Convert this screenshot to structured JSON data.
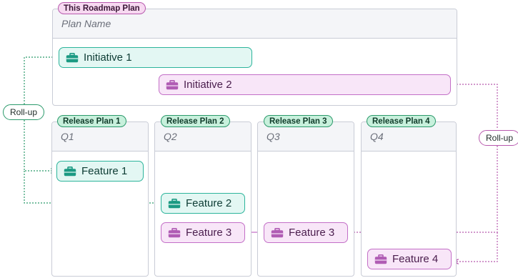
{
  "plan": {
    "tag": "This Roadmap Plan",
    "name_placeholder": "Plan Name"
  },
  "initiatives": [
    {
      "label": "Initiative 1",
      "icon": "briefcase-icon",
      "color": "#2cb49b"
    },
    {
      "label": "Initiative 2",
      "icon": "briefcase-icon",
      "color": "#c36fc7"
    }
  ],
  "release_plans": [
    {
      "tag": "Release Plan 1",
      "quarter": "Q1"
    },
    {
      "tag": "Release Plan 2",
      "quarter": "Q2"
    },
    {
      "tag": "Release Plan 3",
      "quarter": "Q3"
    },
    {
      "tag": "Release Plan 4",
      "quarter": "Q4"
    }
  ],
  "features": [
    {
      "label": "Feature 1",
      "icon": "briefcase-icon"
    },
    {
      "label": "Feature 2",
      "icon": "briefcase-icon"
    },
    {
      "label": "Feature 3",
      "icon": "briefcase-icon"
    },
    {
      "label": "Feature 3",
      "icon": "briefcase-icon"
    },
    {
      "label": "Feature 4",
      "icon": "briefcase-icon"
    }
  ],
  "rollup_labels": {
    "left": "Roll-up",
    "right": "Roll-up"
  },
  "colors": {
    "teal": "#2cb49b",
    "purple": "#c36fc7",
    "tag_green": "#2b9a6b",
    "tag_pink": "#b85aae"
  }
}
